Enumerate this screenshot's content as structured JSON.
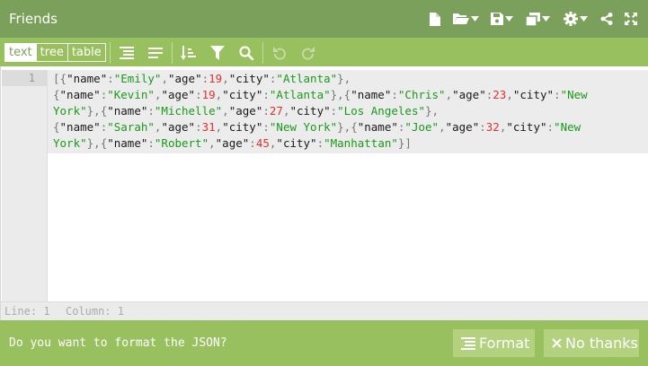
{
  "window": {
    "title": "Friends"
  },
  "title_icons": [
    "new-file-icon",
    "open-folder-icon",
    "save-icon",
    "copy-icon",
    "settings-icon",
    "share-icon",
    "fullscreen-icon"
  ],
  "toolbar": {
    "modes": [
      {
        "label": "text",
        "active": true
      },
      {
        "label": "tree",
        "active": false
      },
      {
        "label": "table",
        "active": false
      }
    ],
    "tools": [
      "format-icon",
      "compact-icon",
      "sort-icon",
      "filter-icon",
      "search-icon",
      "undo-icon",
      "redo-icon"
    ]
  },
  "editor": {
    "line_number": "1",
    "lines": [
      [
        [
          "p",
          "[{"
        ],
        [
          "k",
          "\"name\""
        ],
        [
          "p",
          ":"
        ],
        [
          "s",
          "\"Emily\""
        ],
        [
          "p",
          ","
        ],
        [
          "k",
          "\"age\""
        ],
        [
          "p",
          ":"
        ],
        [
          "n",
          "19"
        ],
        [
          "p",
          ","
        ],
        [
          "k",
          "\"city\""
        ],
        [
          "p",
          ":"
        ],
        [
          "s",
          "\"Atlanta\""
        ],
        [
          "p",
          "},"
        ]
      ],
      [
        [
          "p",
          "{"
        ],
        [
          "k",
          "\"name\""
        ],
        [
          "p",
          ":"
        ],
        [
          "s",
          "\"Kevin\""
        ],
        [
          "p",
          ","
        ],
        [
          "k",
          "\"age\""
        ],
        [
          "p",
          ":"
        ],
        [
          "n",
          "19"
        ],
        [
          "p",
          ","
        ],
        [
          "k",
          "\"city\""
        ],
        [
          "p",
          ":"
        ],
        [
          "s",
          "\"Atlanta\""
        ],
        [
          "p",
          "},{"
        ],
        [
          "k",
          "\"name\""
        ],
        [
          "p",
          ":"
        ],
        [
          "s",
          "\"Chris\""
        ],
        [
          "p",
          ","
        ],
        [
          "k",
          "\"age\""
        ],
        [
          "p",
          ":"
        ],
        [
          "n",
          "23"
        ],
        [
          "p",
          ","
        ],
        [
          "k",
          "\"city\""
        ],
        [
          "p",
          ":"
        ],
        [
          "s",
          "\"New"
        ]
      ],
      [
        [
          "s",
          "York\""
        ],
        [
          "p",
          "},{"
        ],
        [
          "k",
          "\"name\""
        ],
        [
          "p",
          ":"
        ],
        [
          "s",
          "\"Michelle\""
        ],
        [
          "p",
          ","
        ],
        [
          "k",
          "\"age\""
        ],
        [
          "p",
          ":"
        ],
        [
          "n",
          "27"
        ],
        [
          "p",
          ","
        ],
        [
          "k",
          "\"city\""
        ],
        [
          "p",
          ":"
        ],
        [
          "s",
          "\"Los Angeles\""
        ],
        [
          "p",
          "},"
        ]
      ],
      [
        [
          "p",
          "{"
        ],
        [
          "k",
          "\"name\""
        ],
        [
          "p",
          ":"
        ],
        [
          "s",
          "\"Sarah\""
        ],
        [
          "p",
          ","
        ],
        [
          "k",
          "\"age\""
        ],
        [
          "p",
          ":"
        ],
        [
          "n",
          "31"
        ],
        [
          "p",
          ","
        ],
        [
          "k",
          "\"city\""
        ],
        [
          "p",
          ":"
        ],
        [
          "s",
          "\"New York\""
        ],
        [
          "p",
          "},{"
        ],
        [
          "k",
          "\"name\""
        ],
        [
          "p",
          ":"
        ],
        [
          "s",
          "\"Joe\""
        ],
        [
          "p",
          ","
        ],
        [
          "k",
          "\"age\""
        ],
        [
          "p",
          ":"
        ],
        [
          "n",
          "32"
        ],
        [
          "p",
          ","
        ],
        [
          "k",
          "\"city\""
        ],
        [
          "p",
          ":"
        ],
        [
          "s",
          "\"New"
        ]
      ],
      [
        [
          "s",
          "York\""
        ],
        [
          "p",
          "},{"
        ],
        [
          "k",
          "\"name\""
        ],
        [
          "p",
          ":"
        ],
        [
          "s",
          "\"Robert\""
        ],
        [
          "p",
          ","
        ],
        [
          "k",
          "\"age\""
        ],
        [
          "p",
          ":"
        ],
        [
          "n",
          "45"
        ],
        [
          "p",
          ","
        ],
        [
          "k",
          "\"city\""
        ],
        [
          "p",
          ":"
        ],
        [
          "s",
          "\"Manhattan\""
        ],
        [
          "p",
          "}]"
        ]
      ]
    ]
  },
  "status": {
    "line": "Line: 1",
    "column": "Column: 1"
  },
  "prompt": {
    "message": "Do you want to format the JSON?",
    "format_label": "Format",
    "no_thanks_label": "No thanks"
  }
}
